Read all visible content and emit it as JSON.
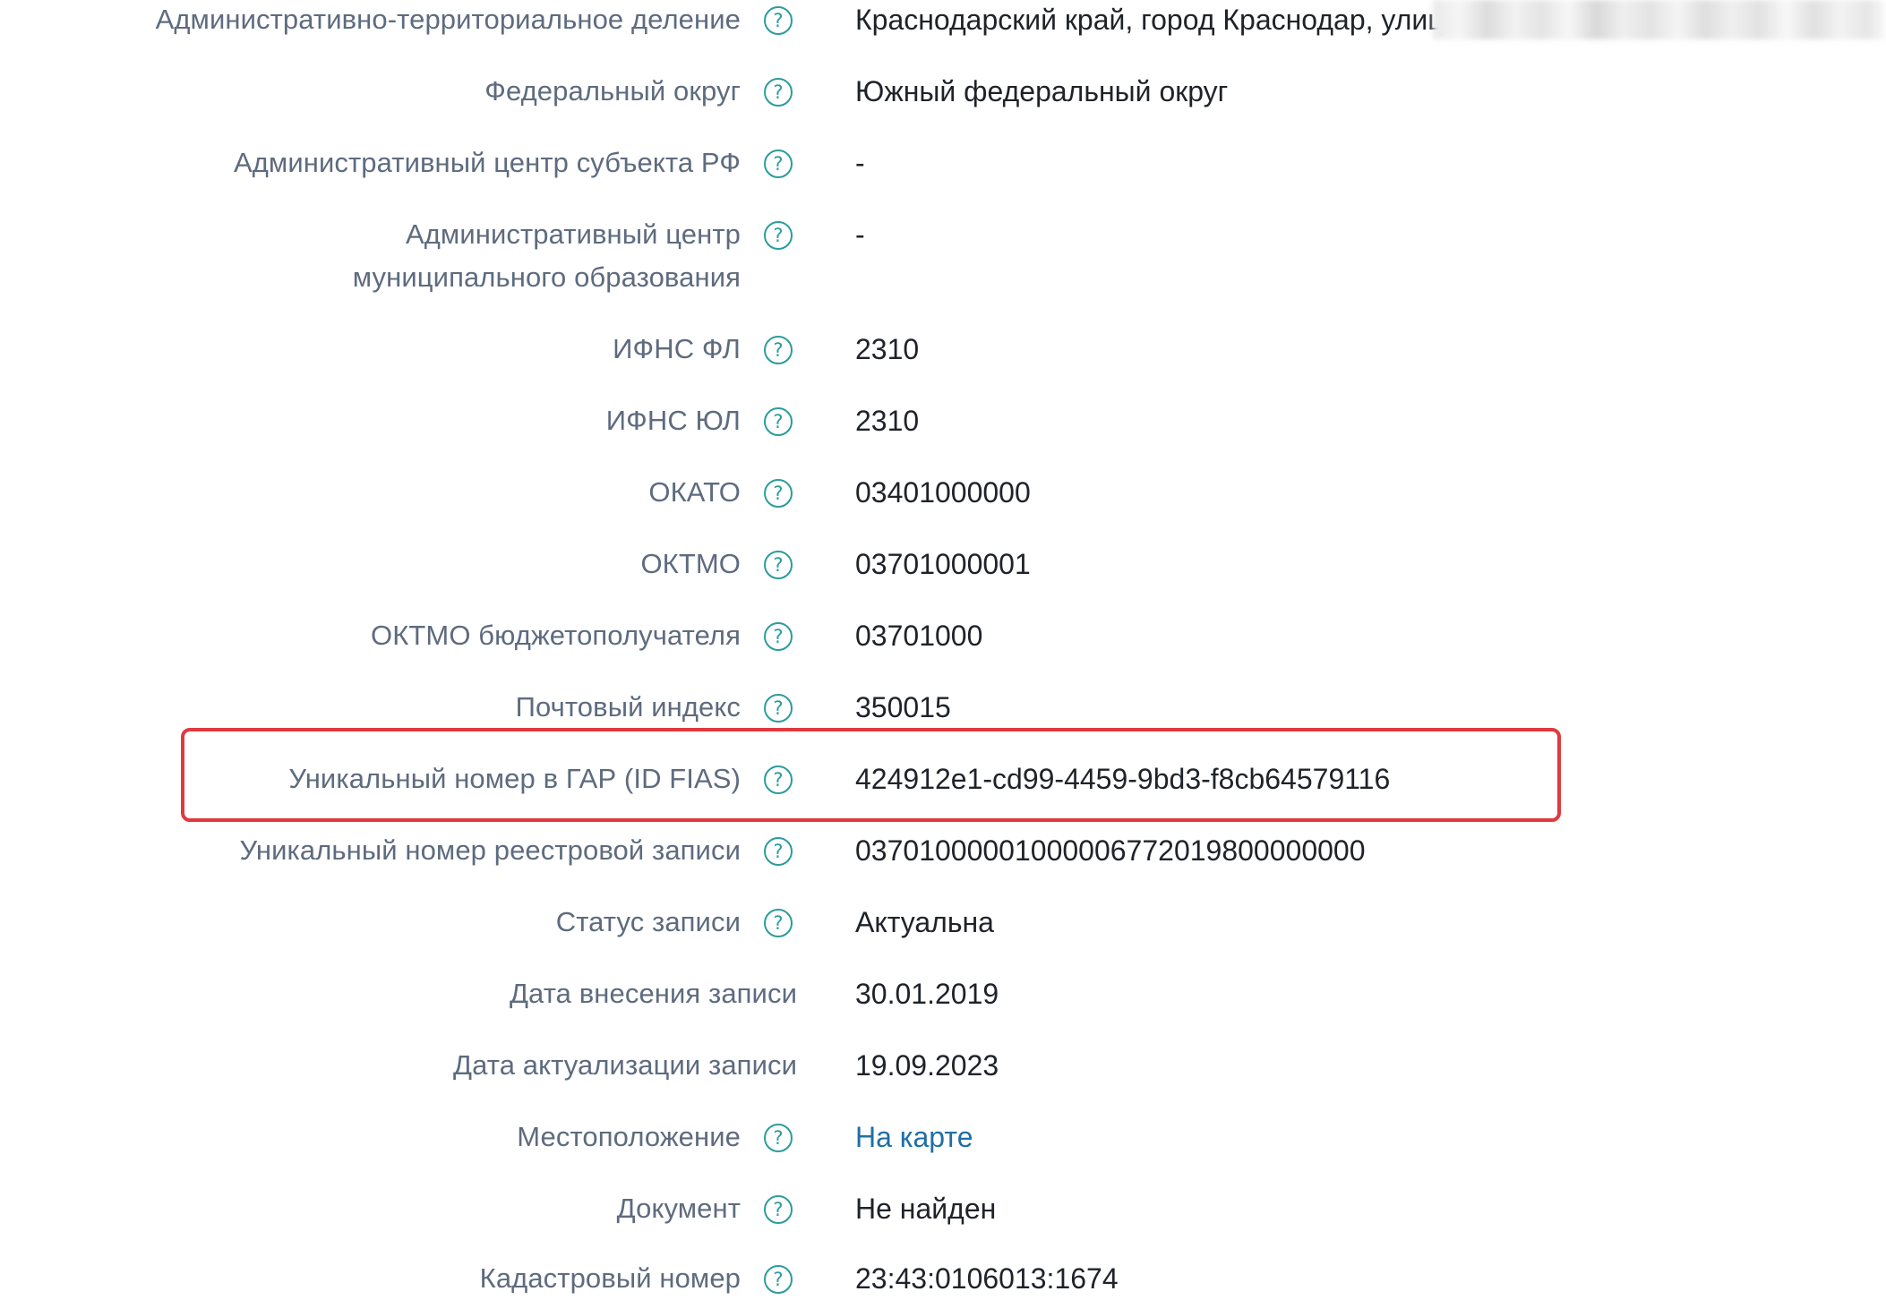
{
  "rows": [
    {
      "label": "Административно-территориальное деление",
      "value": "Краснодарский край, город Краснодар, улиц"
    },
    {
      "label": "Федеральный округ",
      "value": "Южный федеральный округ"
    },
    {
      "label": "Административный центр субъекта РФ",
      "value": "-"
    },
    {
      "label": "Административный центр муниципального образования",
      "value": "-"
    },
    {
      "label": "ИФНС ФЛ",
      "value": "2310"
    },
    {
      "label": "ИФНС ЮЛ",
      "value": "2310"
    },
    {
      "label": "ОКАТО",
      "value": "03401000000"
    },
    {
      "label": "ОКТМО",
      "value": "03701000001"
    },
    {
      "label": "ОКТМО бюджетополучателя",
      "value": "03701000"
    },
    {
      "label": "Почтовый индекс",
      "value": "350015"
    },
    {
      "label": "Уникальный номер в ГАР (ID FIAS)",
      "value": "424912e1-cd99-4459-9bd3-f8cb64579116"
    },
    {
      "label": "Уникальный номер реестровой записи",
      "value": "03701000001000006772019800000000"
    },
    {
      "label": "Статус записи",
      "value": "Актуальна"
    },
    {
      "label": "Дата внесения записи",
      "value": "30.01.2019"
    },
    {
      "label": "Дата актуализации записи",
      "value": "19.09.2023"
    },
    {
      "label": "Местоположение",
      "value": "На карте"
    },
    {
      "label": "Документ",
      "value": "Не найден"
    },
    {
      "label": "Кадастровый номер",
      "value": "23:43:0106013:1674"
    }
  ],
  "help_icon": "?",
  "colors": {
    "label": "#5e6b7f",
    "value": "#1f2329",
    "help": "#2c9c9c",
    "link": "#1f6fa5",
    "highlight": "#e0393e"
  }
}
